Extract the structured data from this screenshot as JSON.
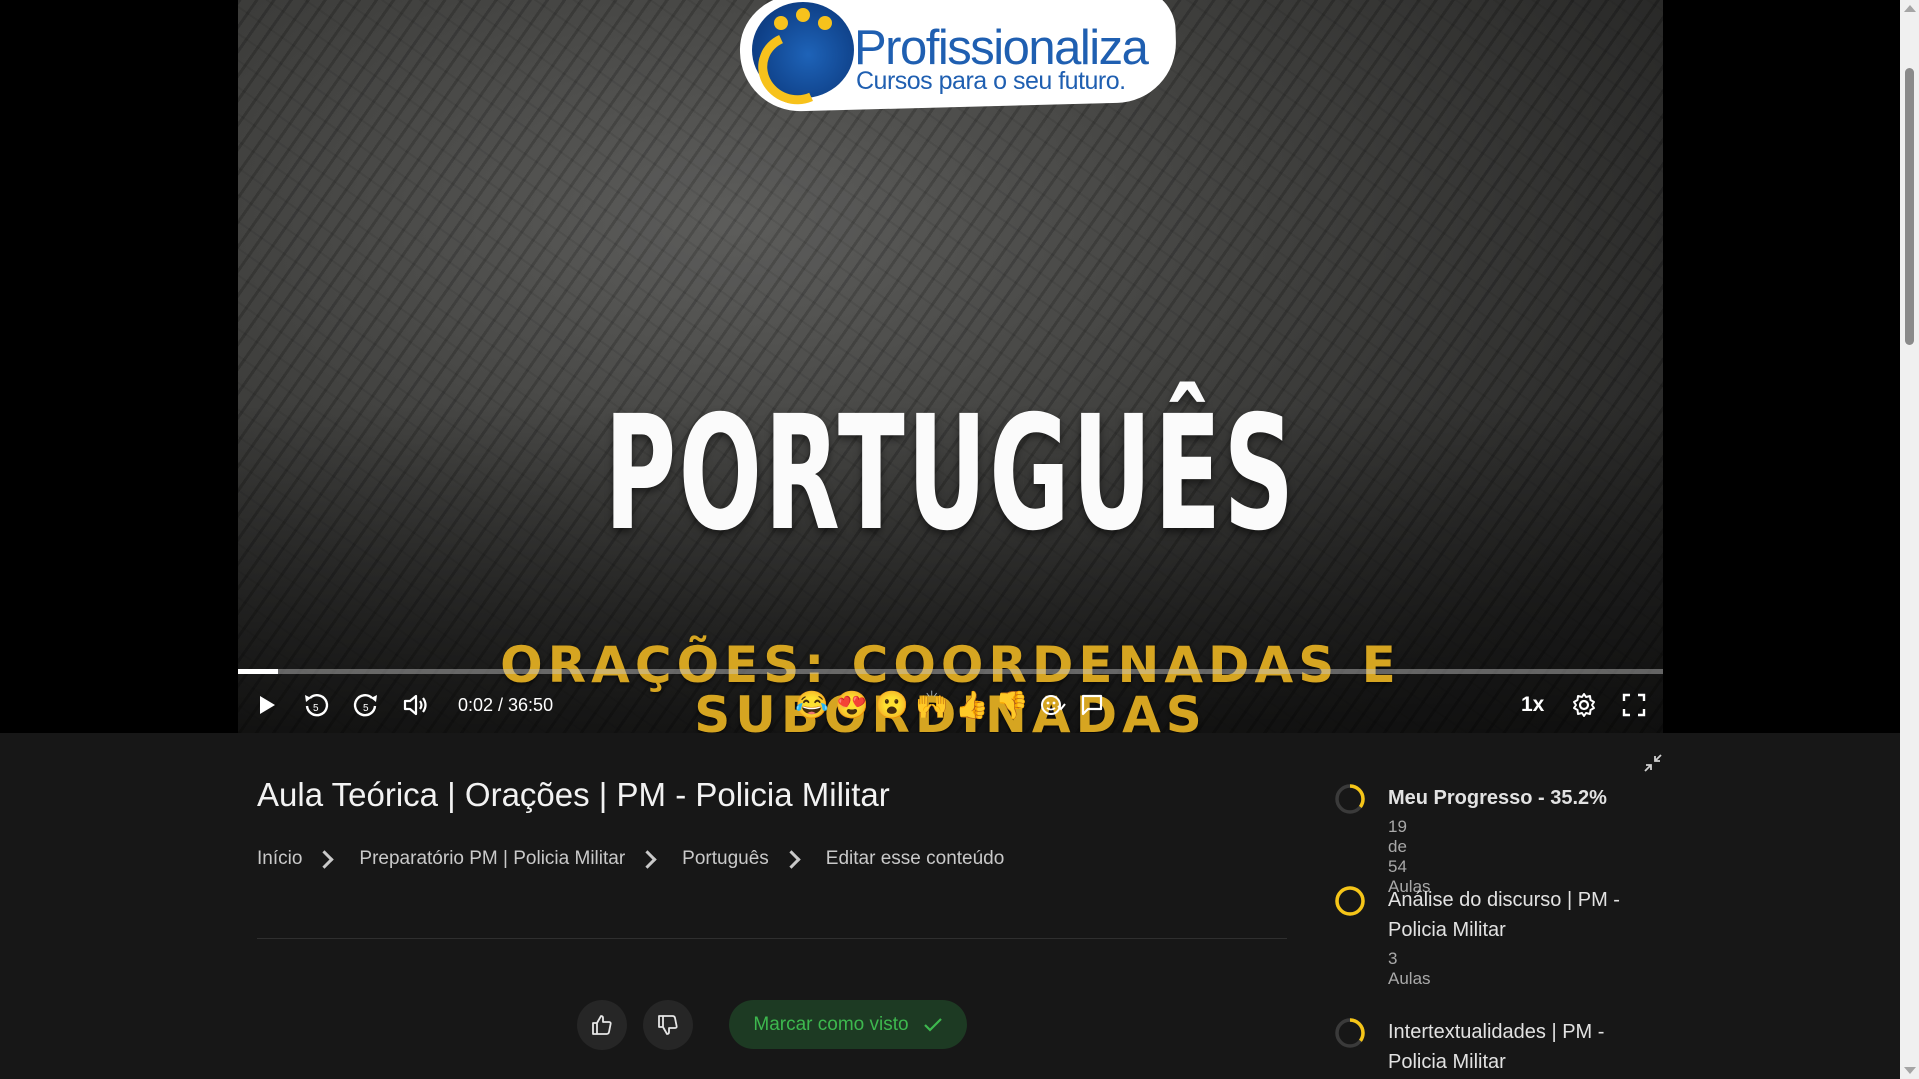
{
  "video": {
    "logo_name": "Profissionaliza",
    "logo_tagline": "Cursos para o seu futuro.",
    "slide_title": "PORTUGUÊS",
    "slide_subtitle": "ORAÇÕES: COORDENADAS E SUBORDINADAS",
    "playback_progress": 0.028,
    "time_display": "0:02 / 36:50",
    "speed_label": "1x",
    "reactions": [
      "😂",
      "😍",
      "😮",
      "🙌",
      "👍",
      "👎"
    ],
    "skip_back_seconds": "5",
    "skip_forward_seconds": "5"
  },
  "lesson": {
    "title": "Aula Teórica | Orações | PM - Policia Militar",
    "breadcrumb": [
      "Início",
      "Preparatório PM | Policia Militar",
      "Português",
      "Editar esse conteúdo"
    ],
    "mark_seen_label": "Marcar como visto"
  },
  "sidebar": {
    "progress_title": "Meu Progresso - 35.2%",
    "progress_value": 0.352,
    "progress_sub": "19 de 54 Aulas",
    "modules": [
      {
        "title": "Análise do discurso | PM - Policia Militar",
        "sub": "3 Aulas",
        "progress": 1.0
      },
      {
        "title": "Intertextualidades | PM - Policia Militar",
        "sub": "",
        "progress": 0.35
      }
    ]
  },
  "colors": {
    "accent_yellow": "#f5c518",
    "mark_seen_green": "#3db84e",
    "background": "#171717"
  }
}
